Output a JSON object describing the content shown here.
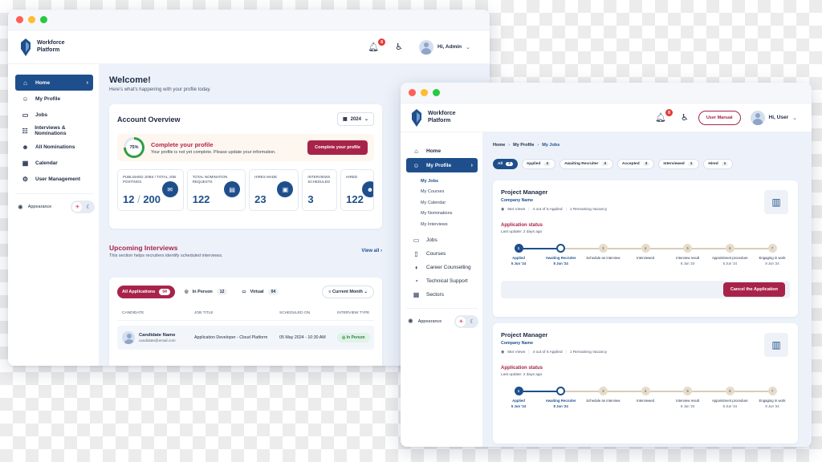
{
  "brand": {
    "name": "Workforce\nPlatform"
  },
  "colors": {
    "primary": "#1e4f8c",
    "accent": "#a8234a",
    "success": "#2f9e44",
    "badge": "#e53935"
  },
  "admin_window": {
    "header": {
      "notification_count": "8",
      "user_label": "Hi, Admin"
    },
    "sidebar": {
      "items": [
        {
          "label": "Home",
          "icon": "home-icon"
        },
        {
          "label": "My Profile",
          "icon": "user-icon"
        },
        {
          "label": "Jobs",
          "icon": "briefcase-icon"
        },
        {
          "label": "Interviews & Nominations",
          "icon": "interview-icon"
        },
        {
          "label": "All Nominations",
          "icon": "users-icon"
        },
        {
          "label": "Calendar",
          "icon": "calendar-icon"
        },
        {
          "label": "User Management",
          "icon": "user-cog-icon"
        }
      ],
      "appearance_label": "Appearance"
    },
    "welcome": {
      "title": "Welcome!",
      "subtitle": "Here's what's happening with your profile today."
    },
    "account_overview": {
      "title": "Account Overview",
      "year": "2024",
      "profile": {
        "percent": "75%",
        "title": "Complete your profile",
        "subtitle": "Your profile is not yet complete. Please update your information.",
        "button": "Complete your profile"
      },
      "stats": [
        {
          "label": "Published Jobs / Total Job Postings",
          "value": "12",
          "total": "200",
          "icon": "mail-icon"
        },
        {
          "label": "Total Nomination Requests",
          "value": "122",
          "icon": "document-icon"
        },
        {
          "label": "Hires Made",
          "value": "23",
          "icon": "id-card-icon"
        },
        {
          "label": "Interviews Scheduled",
          "value": "3"
        },
        {
          "label": "Hired",
          "value": "122",
          "icon": "people-icon"
        }
      ]
    },
    "upcoming": {
      "title": "Upcoming Interviews",
      "subtitle": "This section helps recruiters identify scheduled interviews.",
      "view_all": "View all",
      "filters": [
        {
          "label": "All Applications",
          "count": "04"
        },
        {
          "label": "In Person",
          "count": "12"
        },
        {
          "label": "Virtual",
          "count": "04"
        }
      ],
      "month": "Current Month",
      "columns": [
        "Candidate",
        "Job Title",
        "Scheduled On",
        "Interview Type"
      ],
      "rows": [
        {
          "name": "Candidate Name",
          "email": "candidate@email.com",
          "job": "Application Developer - Cloud Platform",
          "scheduled": "05 May 2024 - 10:30 AM",
          "type": "In Person"
        }
      ]
    }
  },
  "user_window": {
    "header": {
      "notification_count": "8",
      "manual_button": "User Manual",
      "user_label": "Hi, User"
    },
    "sidebar": {
      "items": [
        {
          "label": "Home",
          "icon": "home-icon"
        },
        {
          "label": "My Profile",
          "icon": "user-icon"
        },
        {
          "label": "Jobs",
          "icon": "briefcase-icon"
        },
        {
          "label": "Courses",
          "icon": "book-icon"
        },
        {
          "label": "Career Counselling",
          "icon": "headset-icon"
        },
        {
          "label": "Technical Support",
          "icon": "support-icon"
        },
        {
          "label": "Sectors",
          "icon": "grid-icon"
        }
      ],
      "sub_items": [
        "My Jobs",
        "My Courses",
        "My Calendar",
        "My Nominations",
        "My Interviews"
      ],
      "appearance_label": "Appearance"
    },
    "breadcrumb": [
      "Home",
      "My Profile",
      "My Jobs"
    ],
    "pills": [
      {
        "label": "All",
        "count": "3"
      },
      {
        "label": "Applied",
        "count": "3"
      },
      {
        "label": "Awaiting Recruiter",
        "count": "3"
      },
      {
        "label": "Accepted",
        "count": "3"
      },
      {
        "label": "Interviewed",
        "count": "1"
      },
      {
        "label": "Hired",
        "count": "1"
      }
    ],
    "jobs": [
      {
        "title": "Project Manager",
        "company": "Company Name",
        "views": "564 Views",
        "applied": "4 out of 5 Applied",
        "vacancy": "1 Remaining Vacancy",
        "status_title": "Application status",
        "last_update": "Last update: 2 days ago",
        "cancel": "Cancel the Application"
      },
      {
        "title": "Project Manager",
        "company": "Company Name",
        "views": "564 Views",
        "applied": "4 out of 5 Applied",
        "vacancy": "1 Remaining Vacancy",
        "status_title": "Application status",
        "last_update": "Last update: 2 days ago"
      }
    ],
    "steps": [
      {
        "num": "1",
        "label": "Applied",
        "date": "5 Jun '24",
        "state": "done"
      },
      {
        "num": "2",
        "label": "Awaiting Recruiter",
        "date": "8 Jun '24",
        "state": "current"
      },
      {
        "num": "3",
        "label": "Schedule an interview",
        "date": "",
        "state": "todo"
      },
      {
        "num": "4",
        "label": "Interviewed",
        "date": "",
        "state": "todo"
      },
      {
        "num": "5",
        "label": "Interview result",
        "date": "8 Jun '24",
        "state": "todo"
      },
      {
        "num": "6",
        "label": "Appointment procedure",
        "date": "5 Jun '24",
        "state": "todo"
      },
      {
        "num": "7",
        "label": "Engaging in work",
        "date": "8 Jun '24",
        "state": "todo"
      }
    ]
  }
}
